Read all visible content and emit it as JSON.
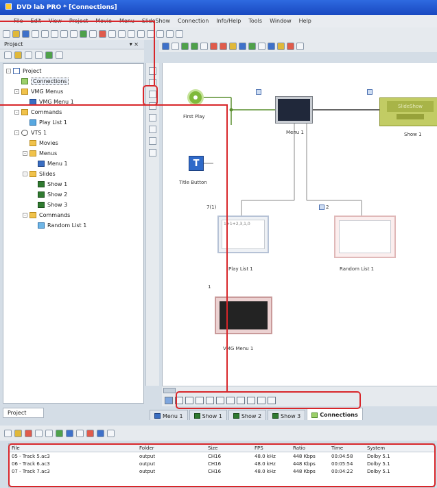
{
  "window": {
    "title": "DVD lab PRO * [Connections]"
  },
  "menu": [
    "File",
    "Edit",
    "View",
    "Project",
    "Movie",
    "Menu",
    "SlideShow",
    "Connection",
    "Info/Help",
    "Tools",
    "Window",
    "Help"
  ],
  "project_panel": {
    "title": "Project",
    "pin": "▾ ×",
    "tree": [
      {
        "label": "Project",
        "indent": 0,
        "icon": "proj",
        "exp": "-"
      },
      {
        "label": "Connections",
        "indent": 1,
        "icon": "conn",
        "exp": "",
        "selected": true
      },
      {
        "label": "VMG Menus",
        "indent": 1,
        "icon": "folder",
        "exp": "-"
      },
      {
        "label": "VMG Menu 1",
        "indent": 2,
        "icon": "menu",
        "exp": ""
      },
      {
        "label": "Commands",
        "indent": 1,
        "icon": "folder",
        "exp": "-"
      },
      {
        "label": "Play List 1",
        "indent": 2,
        "icon": "playlist",
        "exp": ""
      },
      {
        "label": "VTS 1",
        "indent": 1,
        "icon": "vts",
        "exp": "-"
      },
      {
        "label": "Movies",
        "indent": 2,
        "icon": "folder",
        "exp": ""
      },
      {
        "label": "Menus",
        "indent": 2,
        "icon": "folder",
        "exp": "-"
      },
      {
        "label": "Menu 1",
        "indent": 3,
        "icon": "menu",
        "exp": ""
      },
      {
        "label": "Slides",
        "indent": 2,
        "icon": "folder",
        "exp": "-"
      },
      {
        "label": "Show 1",
        "indent": 3,
        "icon": "slide",
        "exp": ""
      },
      {
        "label": "Show 2",
        "indent": 3,
        "icon": "slide",
        "exp": ""
      },
      {
        "label": "Show 3",
        "indent": 3,
        "icon": "slide",
        "exp": ""
      },
      {
        "label": "Commands",
        "indent": 2,
        "icon": "folder",
        "exp": "-"
      },
      {
        "label": "Random List 1",
        "indent": 3,
        "icon": "rlist",
        "exp": ""
      }
    ],
    "tab_label": "Project"
  },
  "canvas": {
    "nodes": {
      "first_play": "First Play",
      "title_button": "Title Button",
      "menu1": "Menu 1",
      "show1": "Show 1",
      "show1_text": "SlideShow",
      "playlist1": "Play List 1",
      "playlist1_text": "1+1+2,3,1,0",
      "playlist1_tag": "7(1)",
      "random1": "Random List 1",
      "vmg1": "VMG Menu 1",
      "vmg_badge": "1",
      "rl_badge": "2"
    }
  },
  "doc_tabs": [
    {
      "label": "Menu 1",
      "icon": "menu"
    },
    {
      "label": "Show 1",
      "icon": "slide"
    },
    {
      "label": "Show 2",
      "icon": "slide"
    },
    {
      "label": "Show 3",
      "icon": "slide"
    },
    {
      "label": "Connections",
      "icon": "conn",
      "active": true
    }
  ],
  "file_table": {
    "headers": [
      "File",
      "Folder",
      "Size",
      "FPS",
      "Ratio",
      "Time",
      "System"
    ],
    "rows": [
      [
        "05 - Track 5.ac3",
        "output",
        "CH16",
        "48.0 kHz",
        "448 Kbps",
        "00:04:58",
        "Dolby 5.1"
      ],
      [
        "06 - Track 6.ac3",
        "output",
        "CH16",
        "48.0 kHz",
        "448 Kbps",
        "00:05:54",
        "Dolby 5.1"
      ],
      [
        "07 - Track 7.ac3",
        "output",
        "CH16",
        "48.0 kHz",
        "448 Kbps",
        "00:04:22",
        "Dolby 5.1"
      ]
    ]
  }
}
